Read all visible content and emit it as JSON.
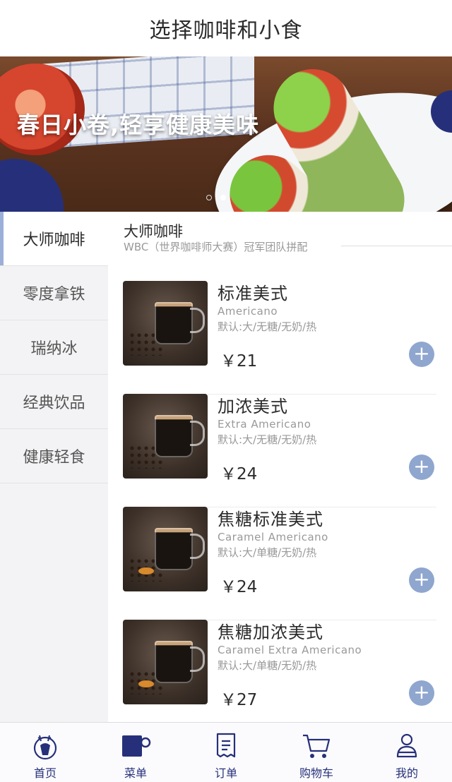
{
  "header": {
    "title": "选择咖啡和小食"
  },
  "banner": {
    "slogan": "春日小卷,轻享健康美味",
    "page_count": 2,
    "active_page": 2
  },
  "sidebar": {
    "items": [
      {
        "label": "大师咖啡",
        "active": true
      },
      {
        "label": "零度拿铁",
        "active": false
      },
      {
        "label": "瑞纳冰",
        "active": false
      },
      {
        "label": "经典饮品",
        "active": false
      },
      {
        "label": "健康轻食",
        "active": false
      }
    ]
  },
  "category": {
    "title": "大师咖啡",
    "subtitle": "WBC（世界咖啡师大赛）冠军团队拼配"
  },
  "products": [
    {
      "name": "标准美式",
      "en": "Americano",
      "spec": "默认:大/无糖/无奶/热",
      "price": "￥21",
      "add_icon": "+"
    },
    {
      "name": "加浓美式",
      "en": "Extra Americano",
      "spec": "默认:大/无糖/无奶/热",
      "price": "￥24",
      "add_icon": "+"
    },
    {
      "name": "焦糖标准美式",
      "en": "Caramel Americano",
      "spec": "默认:大/单糖/无奶/热",
      "price": "￥24",
      "add_icon": "+"
    },
    {
      "name": "焦糖加浓美式",
      "en": "Caramel Extra Americano",
      "spec": "默认:大/单糖/无奶/热",
      "price": "￥27",
      "add_icon": "+"
    }
  ],
  "tabbar": {
    "items": [
      {
        "label": "首页",
        "icon": "deer-logo-icon"
      },
      {
        "label": "菜单",
        "icon": "coffee-cup-icon",
        "active": true
      },
      {
        "label": "订单",
        "icon": "order-list-icon"
      },
      {
        "label": "购物车",
        "icon": "cart-icon"
      },
      {
        "label": "我的",
        "icon": "user-icon"
      }
    ]
  },
  "colors": {
    "brand": "#26307a",
    "accent": "#8fa6cf",
    "sidebar_bg": "#f3f3f5"
  }
}
